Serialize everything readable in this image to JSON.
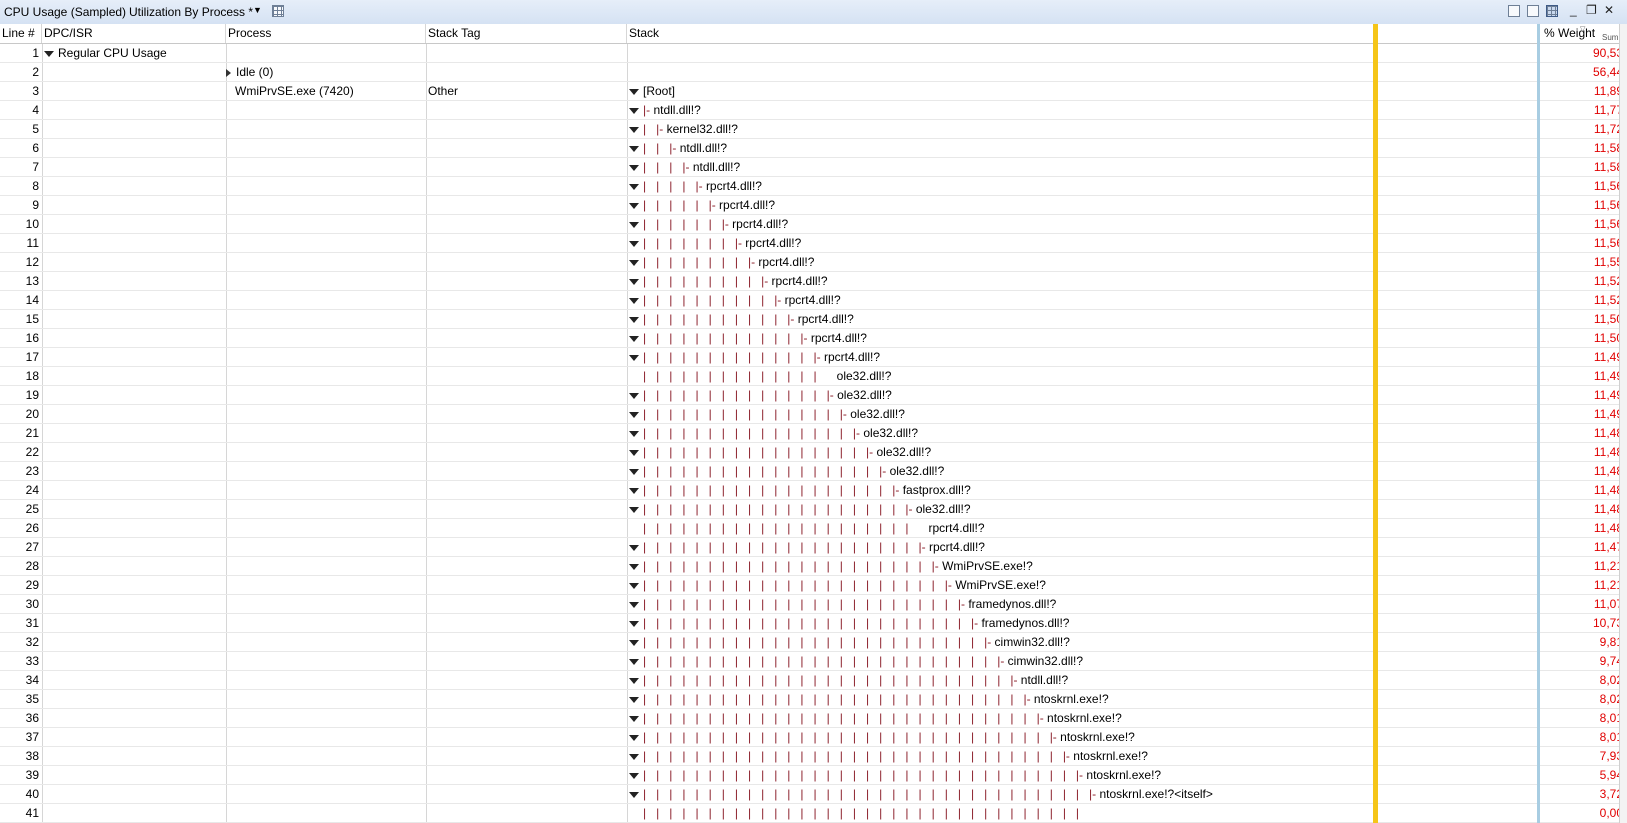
{
  "titlebar": {
    "graph_title": "CPU Usage (Sampled)",
    "preset": "Utilization By Process *"
  },
  "columns": {
    "line": "Line #",
    "dpc": "DPC/ISR",
    "process": "Process",
    "stack_tag": "Stack Tag",
    "stack": "Stack",
    "weight": "% Weight",
    "weight_agg": "Sum"
  },
  "colors": {
    "weight_text": "#e00000",
    "stack_guides": "#8b1f2a",
    "focus_bar": "#f5c518"
  },
  "rows": [
    {
      "line": "1",
      "dpc": "Regular CPU Usage",
      "dpc_expander": "down",
      "weight": "90,53"
    },
    {
      "line": "2",
      "process": "Idle (0)",
      "proc_expander": "right",
      "weight": "56,44"
    },
    {
      "line": "3",
      "process": "WmiPrvSE.exe (7420)",
      "tag": "Other",
      "stack": "[Root]",
      "stack_expander": "down",
      "weight": "11,89"
    },
    {
      "line": "4",
      "depth": 0,
      "prefix": "|- ",
      "stack": "ntdll.dll!?",
      "stack_expander": "down",
      "weight": "11,77"
    },
    {
      "line": "5",
      "depth": 1,
      "prefix": "|- ",
      "stack": "kernel32.dll!?",
      "stack_expander": "down",
      "weight": "11,72"
    },
    {
      "line": "6",
      "depth": 2,
      "prefix": "|- ",
      "stack": "ntdll.dll!?",
      "stack_expander": "down",
      "weight": "11,58"
    },
    {
      "line": "7",
      "depth": 3,
      "prefix": "|- ",
      "stack": "ntdll.dll!?",
      "stack_expander": "down",
      "weight": "11,58"
    },
    {
      "line": "8",
      "depth": 4,
      "prefix": "|- ",
      "stack": "rpcrt4.dll!?",
      "stack_expander": "down",
      "weight": "11,56"
    },
    {
      "line": "9",
      "depth": 5,
      "prefix": "|- ",
      "stack": "rpcrt4.dll!?",
      "stack_expander": "down",
      "weight": "11,56"
    },
    {
      "line": "10",
      "depth": 6,
      "prefix": "|- ",
      "stack": "rpcrt4.dll!?",
      "stack_expander": "down",
      "weight": "11,56"
    },
    {
      "line": "11",
      "depth": 7,
      "prefix": "|- ",
      "stack": "rpcrt4.dll!?",
      "stack_expander": "down",
      "weight": "11,56"
    },
    {
      "line": "12",
      "depth": 8,
      "prefix": "|- ",
      "stack": "rpcrt4.dll!?",
      "stack_expander": "down",
      "weight": "11,55"
    },
    {
      "line": "13",
      "depth": 9,
      "prefix": "|- ",
      "stack": "rpcrt4.dll!?",
      "stack_expander": "down",
      "weight": "11,52"
    },
    {
      "line": "14",
      "depth": 10,
      "prefix": "|- ",
      "stack": "rpcrt4.dll!?",
      "stack_expander": "down",
      "weight": "11,52"
    },
    {
      "line": "15",
      "depth": 11,
      "prefix": "|- ",
      "stack": "rpcrt4.dll!?",
      "stack_expander": "down",
      "weight": "11,50"
    },
    {
      "line": "16",
      "depth": 12,
      "prefix": "|- ",
      "stack": "rpcrt4.dll!?",
      "stack_expander": "down",
      "weight": "11,50"
    },
    {
      "line": "17",
      "depth": 13,
      "prefix": "|- ",
      "stack": "rpcrt4.dll!?",
      "stack_expander": "down",
      "weight": "11,49"
    },
    {
      "line": "18",
      "depth": 14,
      "prefix": "   ",
      "stack": "ole32.dll!?",
      "stack_expander": "",
      "weight": "11,49"
    },
    {
      "line": "19",
      "depth": 14,
      "prefix": "|- ",
      "stack": "ole32.dll!?",
      "stack_expander": "down",
      "weight": "11,49"
    },
    {
      "line": "20",
      "depth": 15,
      "prefix": "|- ",
      "stack": "ole32.dll!?",
      "stack_expander": "down",
      "weight": "11,49"
    },
    {
      "line": "21",
      "depth": 16,
      "prefix": "|- ",
      "stack": "ole32.dll!?",
      "stack_expander": "down",
      "weight": "11,48"
    },
    {
      "line": "22",
      "depth": 17,
      "prefix": "|- ",
      "stack": "ole32.dll!?",
      "stack_expander": "down",
      "weight": "11,48"
    },
    {
      "line": "23",
      "depth": 18,
      "prefix": "|- ",
      "stack": "ole32.dll!?",
      "stack_expander": "down",
      "weight": "11,48"
    },
    {
      "line": "24",
      "depth": 19,
      "prefix": "|- ",
      "stack": "fastprox.dll!?",
      "stack_expander": "down",
      "weight": "11,48"
    },
    {
      "line": "25",
      "depth": 20,
      "prefix": "|- ",
      "stack": "ole32.dll!?",
      "stack_expander": "down",
      "weight": "11,48"
    },
    {
      "line": "26",
      "depth": 21,
      "prefix": "   ",
      "stack": "rpcrt4.dll!?",
      "stack_expander": "",
      "weight": "11,48"
    },
    {
      "line": "27",
      "depth": 21,
      "prefix": "|- ",
      "stack": "rpcrt4.dll!?",
      "stack_expander": "down",
      "weight": "11,47"
    },
    {
      "line": "28",
      "depth": 22,
      "prefix": "|- ",
      "stack": "WmiPrvSE.exe!?",
      "stack_expander": "down",
      "weight": "11,21"
    },
    {
      "line": "29",
      "depth": 23,
      "prefix": "|- ",
      "stack": "WmiPrvSE.exe!?",
      "stack_expander": "down",
      "weight": "11,21"
    },
    {
      "line": "30",
      "depth": 24,
      "prefix": "|- ",
      "stack": "framedynos.dll!?",
      "stack_expander": "down",
      "weight": "11,07"
    },
    {
      "line": "31",
      "depth": 25,
      "prefix": "|- ",
      "stack": "framedynos.dll!?",
      "stack_expander": "down",
      "weight": "10,73"
    },
    {
      "line": "32",
      "depth": 26,
      "prefix": "|- ",
      "stack": "cimwin32.dll!?",
      "stack_expander": "down",
      "weight": "9,81"
    },
    {
      "line": "33",
      "depth": 27,
      "prefix": "|- ",
      "stack": "cimwin32.dll!?",
      "stack_expander": "down",
      "weight": "9,74"
    },
    {
      "line": "34",
      "depth": 28,
      "prefix": "|- ",
      "stack": "ntdll.dll!?",
      "stack_expander": "down",
      "weight": "8,02"
    },
    {
      "line": "35",
      "depth": 29,
      "prefix": "|- ",
      "stack": "ntoskrnl.exe!?",
      "stack_expander": "down",
      "weight": "8,02"
    },
    {
      "line": "36",
      "depth": 30,
      "prefix": "|- ",
      "stack": "ntoskrnl.exe!?",
      "stack_expander": "down",
      "weight": "8,01"
    },
    {
      "line": "37",
      "depth": 31,
      "prefix": "|- ",
      "stack": "ntoskrnl.exe!?",
      "stack_expander": "down",
      "weight": "8,01"
    },
    {
      "line": "38",
      "depth": 32,
      "prefix": "|- ",
      "stack": "ntoskrnl.exe!?",
      "stack_expander": "down",
      "weight": "7,93"
    },
    {
      "line": "39",
      "depth": 33,
      "prefix": "|- ",
      "stack": "ntoskrnl.exe!?",
      "stack_expander": "down",
      "weight": "5,94"
    },
    {
      "line": "40",
      "depth": 34,
      "prefix": "|- ",
      "stack": "ntoskrnl.exe!?<itself>",
      "stack_expander": "down",
      "weight": "3,72"
    },
    {
      "line": "41",
      "depth": 34,
      "prefix": "",
      "stack": "",
      "stack_expander": "",
      "weight": "0,00"
    }
  ]
}
